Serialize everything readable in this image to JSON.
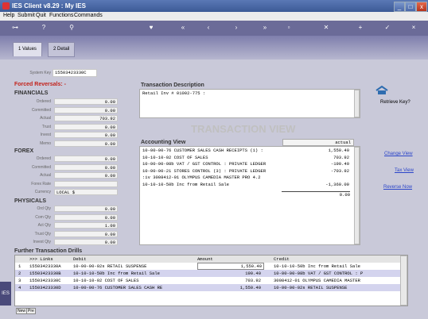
{
  "window": {
    "title": "IES Client v8.29 : My IES",
    "minimize": "_",
    "maximize": "□",
    "close": "x"
  },
  "menu": [
    "Help",
    "Submit",
    "Quit",
    "Functions",
    "Commands"
  ],
  "tabs": [
    "1 Values",
    "2 Detail"
  ],
  "system_key": {
    "label": "System Key",
    "value": "15503423330C"
  },
  "forced_reversals": "Forced Reversals: -",
  "financials": {
    "title": "FINANCIALS",
    "rows": [
      {
        "label": "Ordered",
        "value": "0.00"
      },
      {
        "label": "Committed",
        "value": "0.00"
      },
      {
        "label": "Actual",
        "value": "703.92"
      },
      {
        "label": "Trust",
        "value": "0.00"
      },
      {
        "label": "Invest",
        "value": "0.00"
      },
      {
        "label": "Memo",
        "value": "0.00"
      }
    ]
  },
  "forex": {
    "title": "FOREX",
    "rows": [
      {
        "label": "Ordered",
        "value": "0.00"
      },
      {
        "label": "Committed",
        "value": "0.00"
      },
      {
        "label": "Actual",
        "value": "0.00"
      },
      {
        "label": "Forex Rate",
        "value": ""
      },
      {
        "label": "Currency",
        "value": "LOCAL $"
      }
    ]
  },
  "physicals": {
    "title": "PHYSICALS",
    "rows": [
      {
        "label": "Ord Qty",
        "value": "0.00"
      },
      {
        "label": "Com Qty",
        "value": "0.00"
      },
      {
        "label": "Act Qty",
        "value": "1.00"
      },
      {
        "label": "Trust Qty",
        "value": "0.00"
      },
      {
        "label": "Invest Qty",
        "value": "0.00"
      }
    ]
  },
  "transaction_description": {
    "title": "Transaction Description",
    "text": "Retail Inv # 01002-775 :"
  },
  "watermark": "TRANSACTION VIEW",
  "accounting_view": {
    "title": "Accounting View",
    "column": "actual",
    "rows": [
      {
        "desc": "10-00-00-76 CUSTOMER SALES CASH RECEIPTS (1) :",
        "amount": "1,550.40"
      },
      {
        "desc": "10-10-10-02 COST OF SALES",
        "amount": "703.92"
      },
      {
        "desc": "10-00-00-08b VAT / GST CONTROL : PRIVATE LEDGER",
        "amount": "-190.40"
      },
      {
        "desc": "10-00-00-21 STORES CONTROL (3) : PRIVATE LEDGER",
        "amount": "-703.92"
      },
      {
        "desc": ":iv  3008412-01 OLYMPUS CAMEDIA MASTER PRO 4.2",
        "amount": ""
      },
      {
        "desc": "10-10-10-50b Inc from Retail Sale",
        "amount": "-1,360.00"
      }
    ],
    "total": "0.00"
  },
  "side": {
    "retrieve_key": "Retrieve Key?",
    "links": [
      "Change View",
      "Tax View",
      "Reverse Now"
    ]
  },
  "drills": {
    "title": "Further Transaction Drills",
    "headers": [
      ">>> Links",
      "Debit",
      "Amount",
      "Credit"
    ],
    "rows": [
      {
        "n": "1",
        "link": "15503423330A",
        "debit": "10-00-00-02s RETAIL SUSPENSE",
        "amount": "1,550.40",
        "credit": "10-10-10-50b Inc from Retail Sale"
      },
      {
        "n": "2",
        "link": "15503423330B",
        "debit": "10-10-10-50b Inc from Retail Sale",
        "amount": "190.40",
        "credit": "10-00-00-08b VAT / GST CONTROL : P"
      },
      {
        "n": "3",
        "link": "15503423330C",
        "debit": "10-10-10-02 COST OF SALES",
        "amount": "703.92",
        "credit": "3008412-01 OLYMPUS CAMEDIA MASTER"
      },
      {
        "n": "4",
        "link": "15503423330D",
        "debit": "10-00-00-76 CUSTOMER SALES CASH RE",
        "amount": "1,550.40",
        "credit": "10-00-00-02s RETAIL SUSPENSE"
      }
    ]
  },
  "footer": {
    "side_label": "IES",
    "buttons": [
      "New",
      "Pre"
    ]
  },
  "colors": {
    "toolbar": "#6b6b98",
    "accent_red": "#c3221b",
    "link": "#2b45c9",
    "row_highlight": "#d4d4ee"
  }
}
